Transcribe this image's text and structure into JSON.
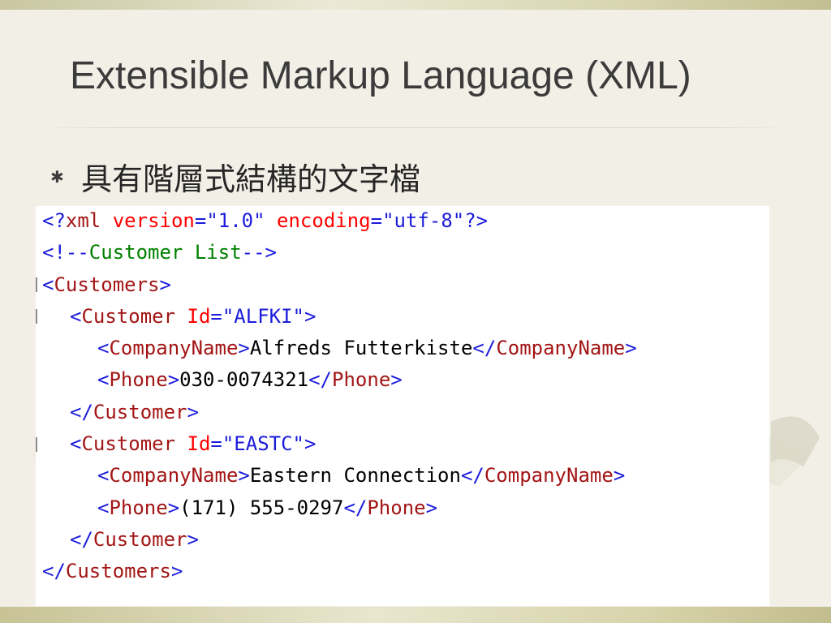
{
  "slide": {
    "title": "Extensible Markup Language (XML)",
    "bullet_symbol": "✱",
    "bullet_text": "具有階層式結構的文字檔"
  },
  "code": {
    "decl": {
      "open": "<?",
      "name": "xml",
      "attr1": "version",
      "eq": "=",
      "val1": "\"1.0\"",
      "attr2": "encoding",
      "val2": "\"utf-8\"",
      "close": "?>"
    },
    "comment": {
      "open": "<!--",
      "text": "Customer List",
      "close": "-->"
    },
    "root_open": "Customers",
    "customers": [
      {
        "tag": "Customer",
        "id_attr": "Id",
        "id_value": "\"ALFKI\"",
        "company_tag": "CompanyName",
        "company_name": "Alfreds Futterkiste",
        "phone_tag": "Phone",
        "phone": "030-0074321"
      },
      {
        "tag": "Customer",
        "id_attr": "Id",
        "id_value": "\"EASTC\"",
        "company_tag": "CompanyName",
        "company_name": "Eastern Connection",
        "phone_tag": "Phone",
        "phone": "(171) 555-0297"
      }
    ],
    "root_close": "Customers",
    "lt": "<",
    "gt": ">",
    "lt_slash": "</",
    "space": " ",
    "eq": "="
  },
  "colors": {
    "bracket": "#1c1cdc",
    "tag_name": "#a31515",
    "attribute": "#ff0000",
    "attribute_value": "#1c1cdc",
    "comment": "#008000",
    "text": "#000000",
    "title": "#3b3b3b"
  }
}
